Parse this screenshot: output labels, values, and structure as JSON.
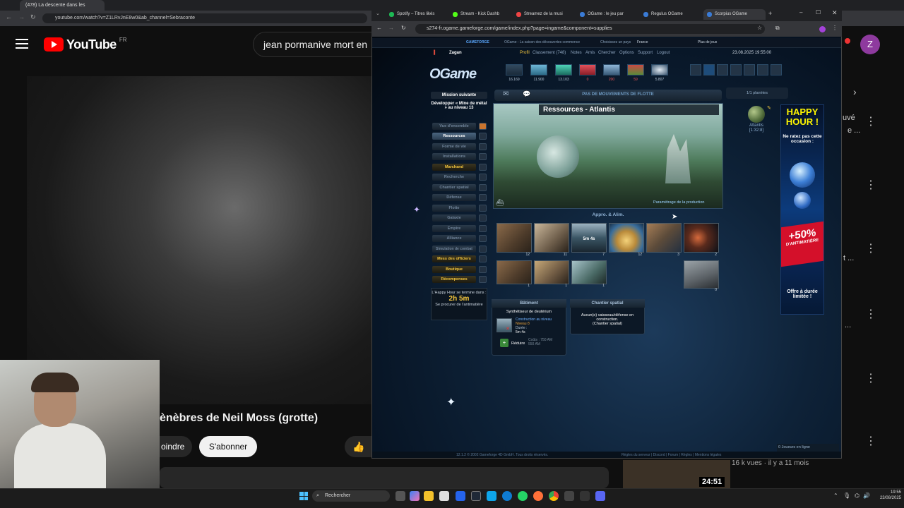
{
  "yt_browser": {
    "tabs": [
      {
        "label": "(478) La descente dans les"
      }
    ],
    "url": "youtube.com/watch?v=Z1LRvJnE8w0&ab_channel=Sebraconte",
    "logo_text": "YouTube",
    "region": "FR",
    "search_value": "jean pormanive mort en",
    "video_title": "ènèbres de Neil Moss (grotte)",
    "join_label": "oindre",
    "subscribe_label": "S'abonner",
    "like_icon": "thumbs-up-icon",
    "avatar_letter": "Z",
    "side_snippets": [
      "uvé",
      "e ...",
      "t ...",
      "..."
    ],
    "related_views": "16 k vues · il y a 11 mois",
    "related_duration": "24:51"
  },
  "og_browser": {
    "tabs": [
      {
        "label": "Spotify – Titres likés",
        "color": "#1db954"
      },
      {
        "label": "Stream - Kick Dashb",
        "color": "#53fc18"
      },
      {
        "label": "Streamez de la musi",
        "color": "#e44"
      },
      {
        "label": "OGame : le jeu par",
        "color": "#3a7bd5"
      },
      {
        "label": "Regulus OGame",
        "color": "#3a7bd5"
      },
      {
        "label": "Scorpius OGame",
        "color": "#3a7bd5"
      }
    ],
    "url": "s274-fr.ogame.gameforge.com/game/index.php?page=ingame&component=supplies"
  },
  "ogame": {
    "topbar": {
      "brand": "GAMEFORGE",
      "tagline": "OGame : La saison des découvertes commence",
      "country_label": "Choisissez un pays",
      "country": "France",
      "more_games": "Plus de jeux"
    },
    "player": "Zagan",
    "nav": [
      "Profil",
      "Classement (748)",
      "Notes",
      "Amis",
      "Chercher",
      "Options",
      "Support",
      "Logout"
    ],
    "datetime": "23.08.2025 19:55:00",
    "logo": "OGame",
    "resources": [
      {
        "name": "metal",
        "value": "16.169"
      },
      {
        "name": "crystal",
        "value": "11.900"
      },
      {
        "name": "deuterium",
        "value": "13.103"
      },
      {
        "name": "energy",
        "value": "0"
      },
      {
        "name": "population",
        "value": "200"
      },
      {
        "name": "food",
        "value": "59"
      },
      {
        "name": "antimatter",
        "value": "5.807"
      }
    ],
    "mission": {
      "title": "Mission suivante",
      "text": "Développer « Mine de métal » au niveau 13"
    },
    "menu": [
      {
        "label": "Vue d'ensemble",
        "state": "normal"
      },
      {
        "label": "Ressources",
        "state": "on"
      },
      {
        "label": "Forme de vie",
        "state": "normal"
      },
      {
        "label": "Installations",
        "state": "normal"
      },
      {
        "label": "Marchand",
        "state": "gold"
      },
      {
        "label": "Recherche",
        "state": "normal"
      },
      {
        "label": "Chantier spatial",
        "state": "normal"
      },
      {
        "label": "Défense",
        "state": "normal"
      },
      {
        "label": "Flotte",
        "state": "normal"
      },
      {
        "label": "Galaxie",
        "state": "normal"
      },
      {
        "label": "Empire",
        "state": "normal"
      },
      {
        "label": "Alliance",
        "state": "normal"
      },
      {
        "label": "Simulation de combat",
        "state": "normal"
      },
      {
        "label": "Mess des officiers",
        "state": "gold"
      },
      {
        "label": "Boutique",
        "state": "gold"
      },
      {
        "label": "Récompenses",
        "state": "gold"
      }
    ],
    "happy_hour": {
      "line1": "L'Happy Hour se termine dans :",
      "time": "2h 5m",
      "line2": "Se procurer de l'antimatière"
    },
    "fleet_status": "PAS DE MOUVEMENTS DE FLOTTE",
    "banner_title": "Ressources - Atlantis",
    "production_link": "Paramétrage de la production",
    "supplies_title": "Appro. & Alim.",
    "tiles_row1": [
      {
        "num": "12"
      },
      {
        "num": "11"
      },
      {
        "num": "7",
        "timer": "5m 4s"
      },
      {
        "num": "12"
      },
      {
        "num": "3"
      },
      {
        "num": "2"
      }
    ],
    "tiles_row2": [
      {
        "num": "1"
      },
      {
        "num": "1"
      },
      {
        "num": "1"
      }
    ],
    "tile_extra": {
      "num": "0"
    },
    "building_panel": {
      "title": "Bâtiment",
      "item": "Synthétiseur de deutérium",
      "status": "Construction au niveau",
      "level": "Niveau 8",
      "duration_label": "Durée :",
      "duration": "5m 4s",
      "reduce": "Réduire",
      "cost_label": "Coûts : 750 AM",
      "cost2": "550 AM"
    },
    "shipyard_panel": {
      "title": "Chantier spatial",
      "text": "Aucun(e) vaisseau/défense en construction.",
      "sub": "(Chantier spatial)"
    },
    "planet_list": "1/1 planètes",
    "planet_name": "Atlantis",
    "planet_coords": "[1:32:8]",
    "ad": {
      "happy": "HAPPY HOUR !",
      "miss": "Ne ratez pas cette occasion :",
      "pct": "+50%",
      "pct_sub": "D'ANTIMATIÈRE",
      "offer": "Offre à durée limitée !"
    },
    "footer_left": "12.1.2 © 2002 Gameforge 4D GmbH. Tous droits réservés.",
    "footer_right": "Règles du serveur | Discord | Forum | Règles | Mentions légales",
    "online": "0 Joueurs en ligne"
  },
  "taskbar": {
    "search": "Rechercher",
    "time": "19:55",
    "date": "23/08/2025"
  }
}
